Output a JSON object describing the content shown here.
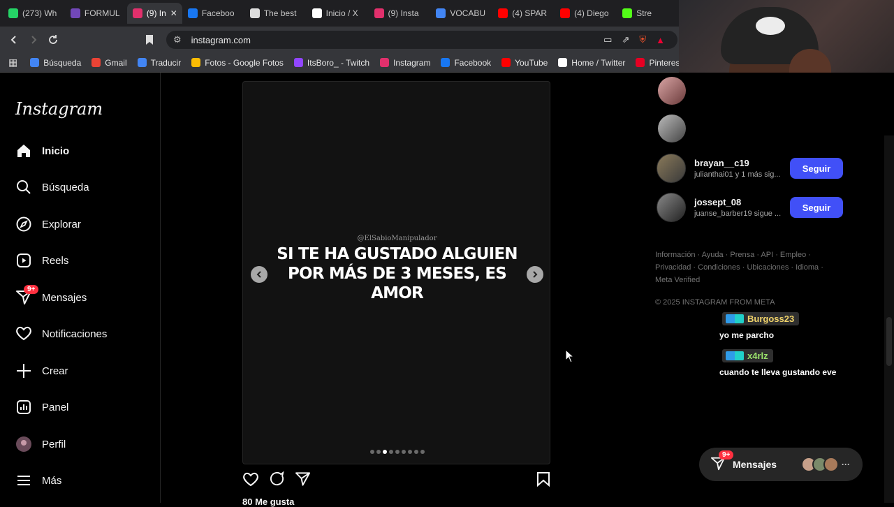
{
  "browser": {
    "tabs": [
      {
        "label": "(273) Wh",
        "icon": "whatsapp-icon",
        "color": "#25d366"
      },
      {
        "label": "FORMUL",
        "icon": "forms-icon",
        "color": "#7248b9"
      },
      {
        "label": "(9) In",
        "icon": "instagram-icon",
        "color": "#e1306c",
        "active": true
      },
      {
        "label": "Faceboo",
        "icon": "facebook-icon",
        "color": "#1877f2"
      },
      {
        "label": "The best",
        "icon": "diamond-icon",
        "color": "#dddddd"
      },
      {
        "label": "Inicio / X",
        "icon": "x-icon",
        "color": "#ffffff"
      },
      {
        "label": "(9) Insta",
        "icon": "instagram-icon",
        "color": "#e1306c"
      },
      {
        "label": "VOCABU",
        "icon": "google-icon",
        "color": "#4285f4"
      },
      {
        "label": "(4) SPAR",
        "icon": "youtube-icon",
        "color": "#ff0000"
      },
      {
        "label": "(4) Diego",
        "icon": "youtube-icon",
        "color": "#ff0000"
      },
      {
        "label": "Stre",
        "icon": "kick-icon",
        "color": "#53fc18"
      }
    ],
    "tab_close": "✕",
    "url": "instagram.com",
    "bookmarks": [
      {
        "label": "Búsqueda",
        "color": "#4285f4"
      },
      {
        "label": "Gmail",
        "color": "#ea4335"
      },
      {
        "label": "Traducir",
        "color": "#4285f4"
      },
      {
        "label": "Fotos - Google Fotos",
        "color": "#fbbc04"
      },
      {
        "label": "ItsBoro_ - Twitch",
        "color": "#9146ff"
      },
      {
        "label": "Instagram",
        "color": "#e1306c"
      },
      {
        "label": "Facebook",
        "color": "#1877f2"
      },
      {
        "label": "YouTube",
        "color": "#ff0000"
      },
      {
        "label": "Home / Twitter",
        "color": "#ffffff"
      },
      {
        "label": "Pinterest -",
        "color": "#e60023"
      }
    ]
  },
  "instagram": {
    "logo": "Instagram",
    "nav": [
      {
        "label": "Inicio",
        "icon": "home-icon",
        "active": true
      },
      {
        "label": "Búsqueda",
        "icon": "search-icon"
      },
      {
        "label": "Explorar",
        "icon": "compass-icon"
      },
      {
        "label": "Reels",
        "icon": "reels-icon"
      },
      {
        "label": "Mensajes",
        "icon": "messenger-icon",
        "badge": "9+"
      },
      {
        "label": "Notificaciones",
        "icon": "heart-icon"
      },
      {
        "label": "Crear",
        "icon": "plus-icon"
      },
      {
        "label": "Panel",
        "icon": "dashboard-icon"
      },
      {
        "label": "Perfil",
        "icon": "avatar-icon"
      },
      {
        "label": "Más",
        "icon": "menu-icon"
      }
    ],
    "post": {
      "watermark": "@ElSabioManipulador",
      "text_lines": [
        "SI TE HA GUSTADO ALGUIEN",
        "POR MÁS DE 3 MESES, ES",
        "AMOR"
      ],
      "dots_total": 9,
      "dots_active_index": 2,
      "likes": "80 Me gusta"
    },
    "suggestions": [
      {
        "name": "brayan__c19",
        "sub": "julianthai01 y 1 más sig...",
        "button": "Seguir"
      },
      {
        "name": "jossept_08",
        "sub": "juanse_barber19 sigue ...",
        "button": "Seguir"
      }
    ],
    "footer_lines": [
      "Información · Ayuda · Prensa · API · Empleo ·",
      "Privacidad · Condiciones · Ubicaciones · Idioma ·",
      "Meta Verified"
    ],
    "copyright": "© 2025 INSTAGRAM FROM META",
    "messages_bar": {
      "label": "Mensajes",
      "badge": "9+",
      "more": "···"
    }
  },
  "stream_chat": [
    {
      "user": "Burgoss23",
      "user_color": "#f0d36a",
      "text": "yo me parcho"
    },
    {
      "user": "x4rlz",
      "user_color": "#9be36b",
      "text": "cuando te lleva gustando eve"
    }
  ]
}
